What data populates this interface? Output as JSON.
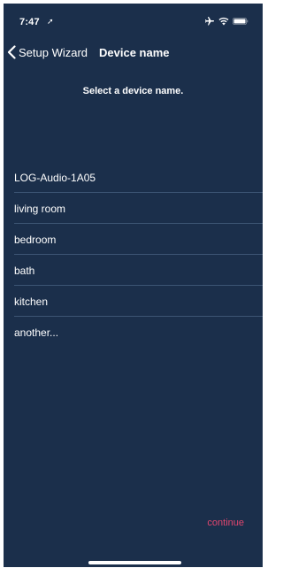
{
  "status_bar": {
    "time": "7:47",
    "location_icon": "location-arrow-icon",
    "airplane_icon": "airplane-icon",
    "wifi_icon": "wifi-icon",
    "battery_icon": "battery-icon"
  },
  "nav": {
    "back_label": "Setup Wizard",
    "title": "Device name"
  },
  "prompt": "Select a device name.",
  "names": [
    {
      "label": "LOG-Audio-1A05"
    },
    {
      "label": "living room"
    },
    {
      "label": "bedroom"
    },
    {
      "label": "bath"
    },
    {
      "label": "kitchen"
    },
    {
      "label": "another..."
    }
  ],
  "continue_label": "continue",
  "colors": {
    "background": "#1b2f4b",
    "text": "#ffffff",
    "divider": "#3d5574",
    "accent": "#e0466f"
  }
}
